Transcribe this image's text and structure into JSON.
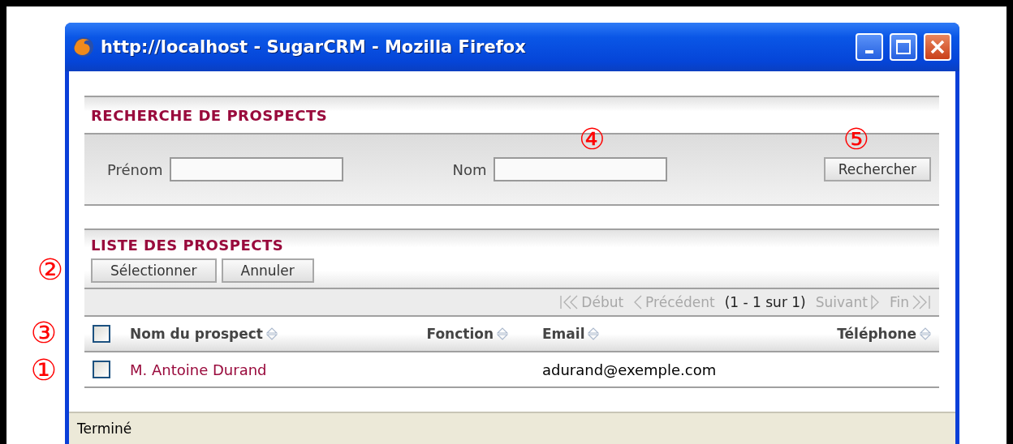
{
  "window": {
    "title": "http://localhost - SugarCRM - Mozilla Firefox"
  },
  "search": {
    "title": "RECHERCHE DE PROSPECTS",
    "fields": [
      {
        "label": "Prénom"
      },
      {
        "label": "Nom",
        "annotation": "④"
      }
    ],
    "button": {
      "label": "Rechercher",
      "annotation": "⑤"
    }
  },
  "list": {
    "title": "LISTE DES PROSPECTS",
    "annotation": "②",
    "buttons": [
      "Sélectionner",
      "Annuler"
    ],
    "pagination": [
      {
        "kind": "first",
        "label": "Début",
        "disabled": true
      },
      {
        "kind": "prev",
        "label": "Précédent",
        "disabled": true
      },
      {
        "kind": "count",
        "label": "(1 - 1 sur 1)"
      },
      {
        "kind": "next",
        "label": "Suivant",
        "disabled": true
      },
      {
        "kind": "last",
        "label": "Fin",
        "disabled": true
      }
    ],
    "header": {
      "checked": false,
      "annotation": "③"
    },
    "columns": [
      {
        "label": "Nom du prospect"
      },
      {
        "label": "Fonction"
      },
      {
        "label": "Email"
      },
      {
        "label": "Téléphone"
      }
    ],
    "rows": [
      {
        "checked": false,
        "annotation": "①",
        "name": "M. Antoine Durand",
        "email": "adurand@exemple.com"
      }
    ]
  },
  "status_bar": "Terminé"
}
